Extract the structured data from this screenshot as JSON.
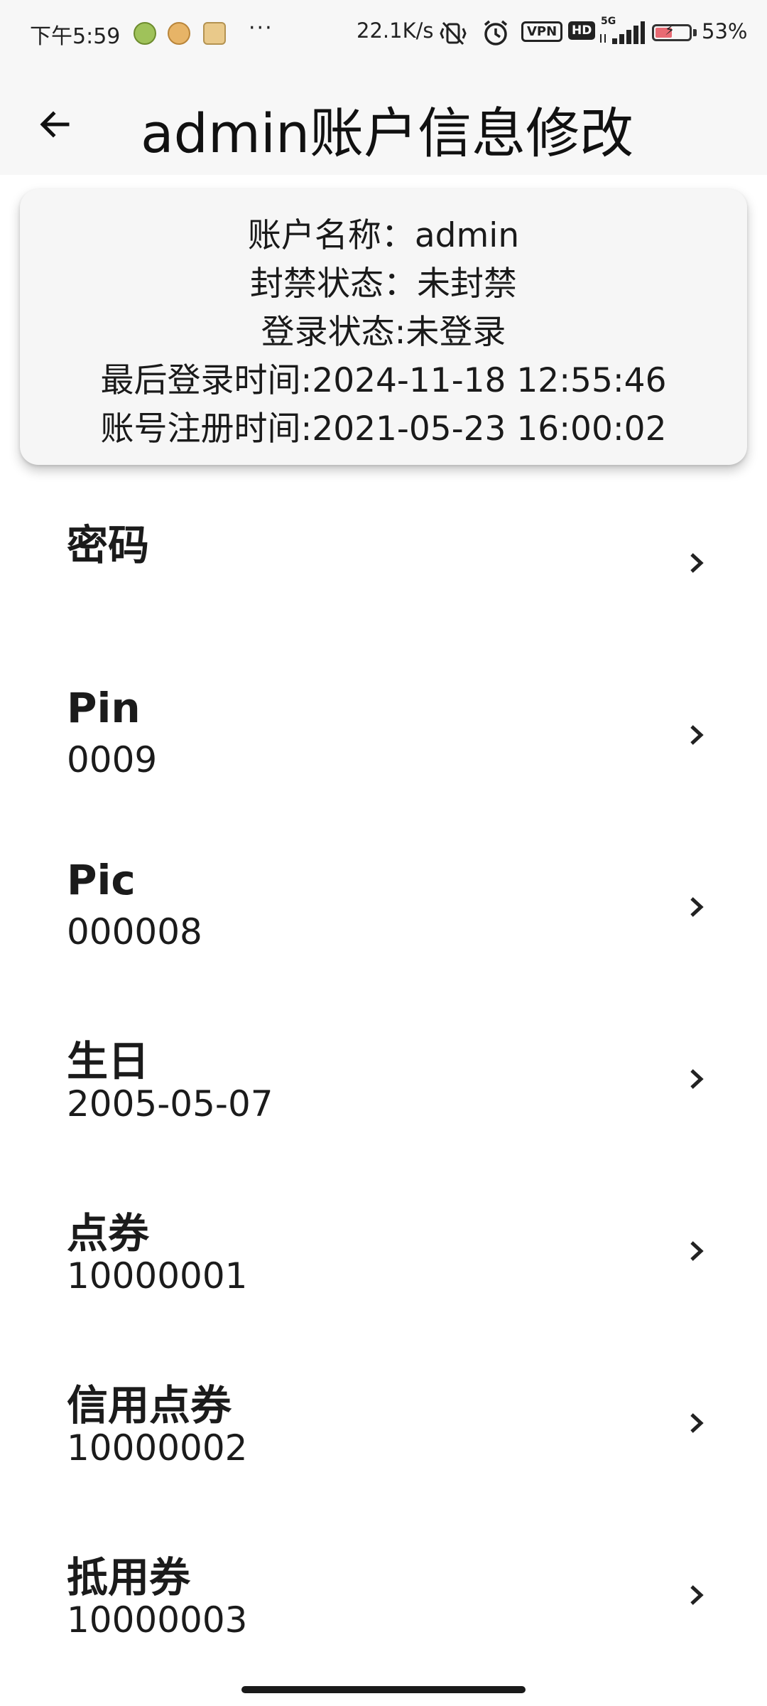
{
  "status_bar": {
    "time": "下午5:59",
    "more": "···",
    "network_speed": "22.1K/s",
    "vpn": "VPN",
    "hd": "HD",
    "network_type": "5G",
    "battery_percent": "53%",
    "battery_level": 0.53
  },
  "header": {
    "back_icon": "arrow-left-icon",
    "title": "admin账户信息修改"
  },
  "account_card": {
    "account_name": "账户名称：admin",
    "ban_status": "封禁状态：未封禁",
    "login_status": "登录状态:未登录",
    "last_login": "最后登录时间:2024-11-18 12:55:46",
    "registered": "账号注册时间:2021-05-23 16:00:02"
  },
  "fields": [
    {
      "label": "密码",
      "value": ""
    },
    {
      "label": "Pin",
      "value": "0009"
    },
    {
      "label": "Pic",
      "value": "000008"
    },
    {
      "label": "生日",
      "value": "2005-05-07"
    },
    {
      "label": "点券",
      "value": "10000001"
    },
    {
      "label": "信用点券",
      "value": "10000002"
    },
    {
      "label": "抵用券",
      "value": "10000003"
    }
  ],
  "colors": {
    "background": "#ffffff",
    "bar_background": "#f7f7f7",
    "card_background": "#f6f6f6",
    "text": "#1b1b1b",
    "battery_low": "#e86a73"
  }
}
